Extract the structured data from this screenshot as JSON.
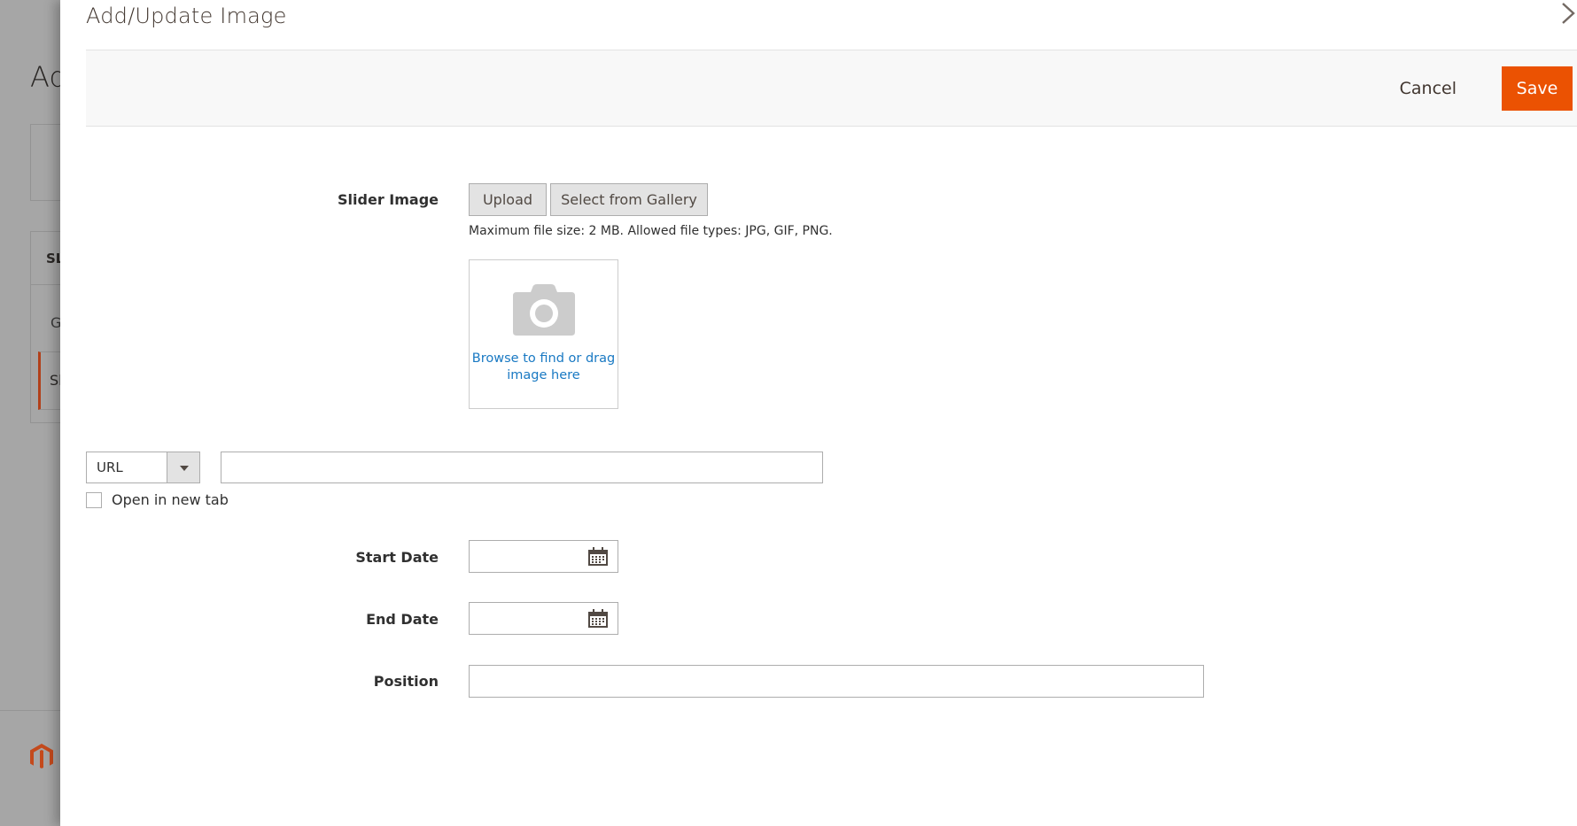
{
  "background_page": {
    "title_fragment": "Ad",
    "section_fragment": "SL",
    "item_fragment_1": "G",
    "item_fragment_2": "Sl",
    "accent_color": "#b2401a"
  },
  "modal": {
    "title": "Add/Update Image",
    "actions": {
      "cancel_label": "Cancel",
      "save_label": "Save",
      "save_color": "#eb5202"
    },
    "slider_image": {
      "label": "Slider Image",
      "upload_label": "Upload",
      "gallery_label": "Select from Gallery",
      "help_text": "Maximum file size: 2 MB. Allowed file types: JPG, GIF, PNG.",
      "dropzone_text": "Browse to find or drag image here",
      "dropzone_color": "#1979c3"
    },
    "link": {
      "type_selected": "URL",
      "url_value": "",
      "open_new_tab_label": "Open in new tab",
      "open_new_tab_checked": false
    },
    "start_date": {
      "label": "Start Date",
      "value": ""
    },
    "end_date": {
      "label": "End Date",
      "value": ""
    },
    "position": {
      "label": "Position",
      "value": ""
    }
  }
}
